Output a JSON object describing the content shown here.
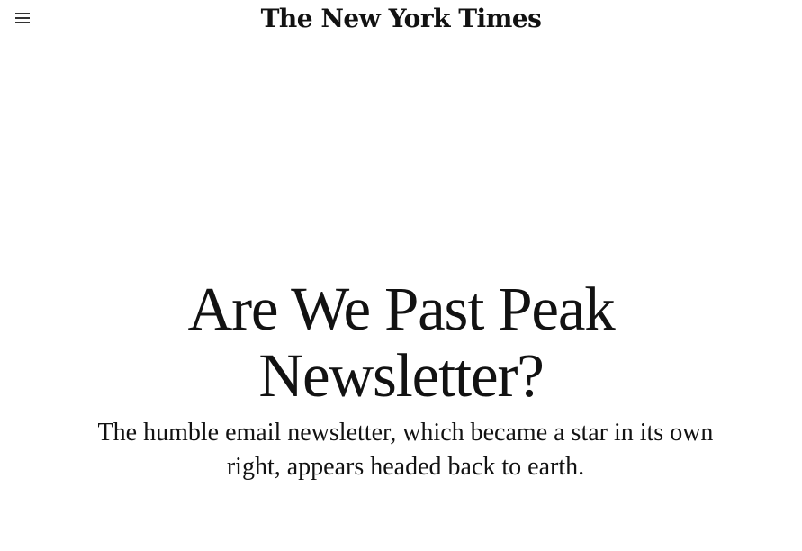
{
  "header": {
    "menu_icon": "hamburger-menu-icon",
    "masthead": "The New York Times"
  },
  "article": {
    "headline_line1": "Are We Past Peak",
    "headline_line2": "Newsletter?",
    "summary": "The humble email newsletter, which became a star in its own right, appears headed back to earth."
  }
}
